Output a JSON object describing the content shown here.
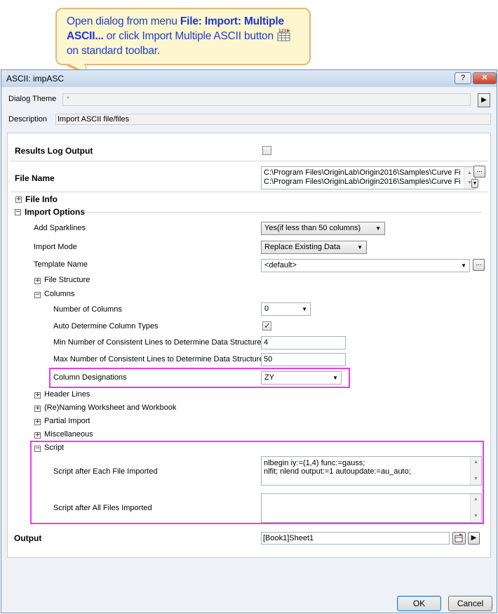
{
  "callout": {
    "line1_pre": "Open dialog from menu ",
    "line1_bold": "File:  Import: Multiple",
    "line2_bold": "ASCII...",
    "line2_post": " or click Import Multiple ASCII button",
    "line3": "on standard toolbar."
  },
  "window": {
    "title": "ASCII: impASC",
    "help": "?",
    "close": "✕"
  },
  "theme": {
    "label": "Dialog Theme",
    "value": "*"
  },
  "description": {
    "label": "Description",
    "value": "Import ASCII file/files"
  },
  "results_log": {
    "label": "Results Log Output",
    "checked": false
  },
  "file_name": {
    "label": "File Name",
    "line1": "C:\\Program Files\\OriginLab\\Origin2016\\Samples\\Curve Fi",
    "line2": "C:\\Program Files\\OriginLab\\Origin2016\\Samples\\Curve Fi",
    "browse": "..."
  },
  "file_info": {
    "label": "File Info",
    "expander": "+"
  },
  "import_options": {
    "label": "Import Options",
    "expander": "−",
    "add_sparklines": {
      "label": "Add Sparklines",
      "value": "Yes(if less than 50 columns)"
    },
    "import_mode": {
      "label": "Import Mode",
      "value": "Replace Existing Data"
    },
    "template_name": {
      "label": "Template Name",
      "value": "<default>",
      "browse": "..."
    },
    "file_structure": {
      "label": "File Structure",
      "expander": "+"
    },
    "columns": {
      "label": "Columns",
      "expander": "−",
      "number_of_columns": {
        "label": "Number of Columns",
        "value": "0"
      },
      "auto_determine": {
        "label": "Auto Determine Column Types",
        "checked": true
      },
      "min_lines": {
        "label": "Min Number of Consistent Lines to Determine Data Structure",
        "value": "4"
      },
      "max_lines": {
        "label": "Max Number of Consistent Lines to Determine Data Structure",
        "value": "50"
      },
      "designations": {
        "label": "Column Designations",
        "value": "ZY"
      }
    },
    "header_lines": {
      "label": "Header Lines",
      "expander": "+"
    },
    "renaming": {
      "label": "(Re)Naming Worksheet and Workbook",
      "expander": "+"
    },
    "partial_import": {
      "label": "Partial Import",
      "expander": "+"
    },
    "miscellaneous": {
      "label": "Miscellaneous",
      "expander": "+"
    },
    "script": {
      "label": "Script",
      "expander": "−",
      "each_file": {
        "label": "Script after Each File Imported",
        "line1": "nlbegin iy:=(1,4) func:=gauss;",
        "line2": "nlfit; nlend output:=1 autoupdate:=au_auto;"
      },
      "all_files": {
        "label": "Script after All Files Imported",
        "value": ""
      }
    }
  },
  "output": {
    "label": "Output",
    "value": "[Book1]Sheet1",
    "arrow": "▶"
  },
  "buttons": {
    "ok": "OK",
    "cancel": "Cancel"
  },
  "colors": {
    "highlight": "#ef38ef",
    "callout_text": "#1f3fcf",
    "callout_bg": "#fdf6cf"
  }
}
